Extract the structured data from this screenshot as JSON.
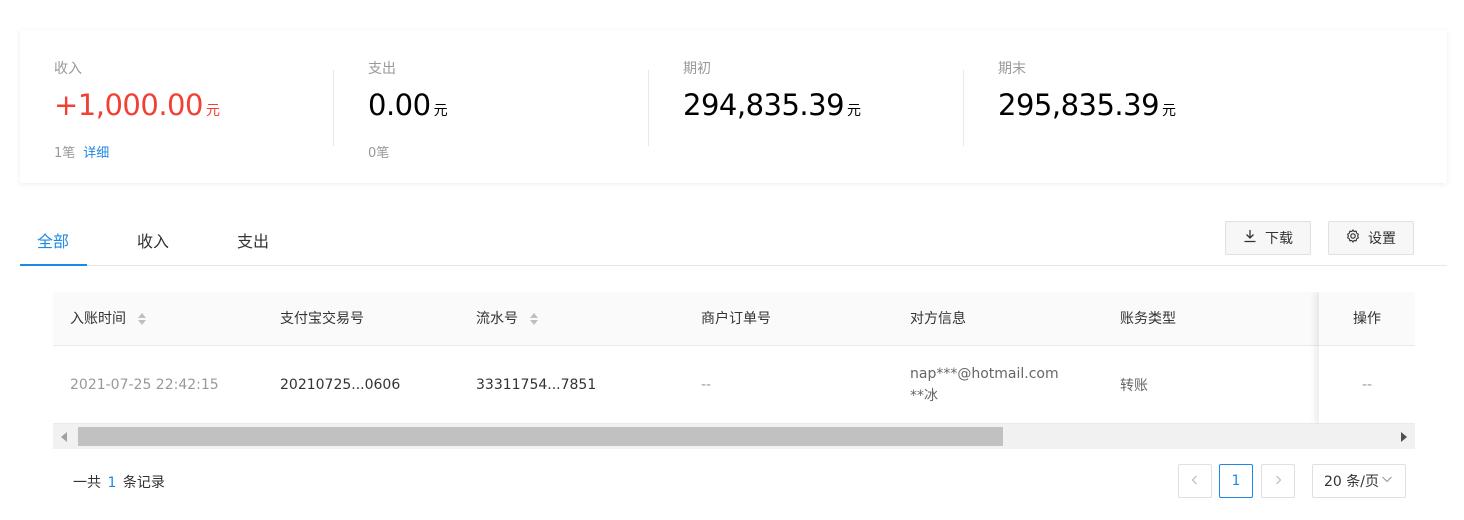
{
  "summary": {
    "income": {
      "label": "收入",
      "value": "+1,000.00",
      "unit": "元",
      "count": "1笔",
      "detail_link": "详细"
    },
    "expense": {
      "label": "支出",
      "value": "0.00",
      "unit": "元",
      "count": "0笔"
    },
    "opening": {
      "label": "期初",
      "value": "294,835.39",
      "unit": "元"
    },
    "closing": {
      "label": "期末",
      "value": "295,835.39",
      "unit": "元"
    }
  },
  "tabs": [
    {
      "label": "全部",
      "active": true
    },
    {
      "label": "收入",
      "active": false
    },
    {
      "label": "支出",
      "active": false
    }
  ],
  "toolbar": {
    "download_label": "下载",
    "settings_label": "设置"
  },
  "table": {
    "columns": [
      "入账时间",
      "支付宝交易号",
      "流水号",
      "商户订单号",
      "对方信息",
      "账务类型",
      "操作"
    ],
    "rows": [
      {
        "time": "2021-07-25 22:42:15",
        "alipay_trade_no": "20210725...0606",
        "serial_no": "33311754...7851",
        "merchant_order_no": "--",
        "counterparty_account": "nap***@hotmail.com",
        "counterparty_name": "**冰",
        "type": "转账",
        "action": "--"
      }
    ]
  },
  "footer": {
    "total_prefix": "一共",
    "total_count": "1",
    "total_suffix": "条记录",
    "current_page": "1",
    "page_size": "20 条/页"
  },
  "colors": {
    "accent": "#1e88e5",
    "income": "#f04134"
  }
}
